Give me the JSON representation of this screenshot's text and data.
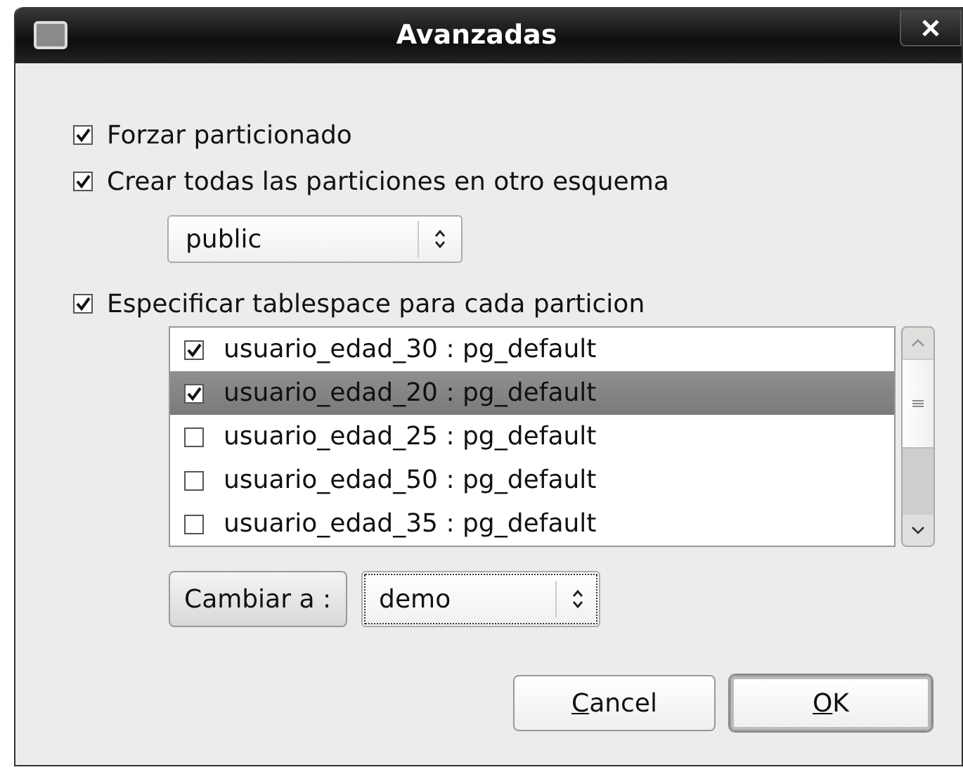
{
  "window": {
    "title": "Avanzadas"
  },
  "options": [
    {
      "label": "Forzar particionado",
      "checked": true
    },
    {
      "label": "Crear todas las particiones en otro esquema",
      "checked": true
    }
  ],
  "schema_combo": {
    "value": "public"
  },
  "tablespace_option": {
    "label": "Especificar tablespace para cada particion",
    "checked": true
  },
  "partitions": [
    {
      "label": "usuario_edad_30 : pg_default",
      "checked": true,
      "selected": false
    },
    {
      "label": "usuario_edad_20 : pg_default",
      "checked": true,
      "selected": true
    },
    {
      "label": "usuario_edad_25 : pg_default",
      "checked": false,
      "selected": false
    },
    {
      "label": "usuario_edad_50 : pg_default",
      "checked": false,
      "selected": false
    },
    {
      "label": "usuario_edad_35 : pg_default",
      "checked": false,
      "selected": false
    }
  ],
  "change_button": {
    "label": "Cambiar a :"
  },
  "tablespace_combo": {
    "value": "demo",
    "focused": true
  },
  "buttons": [
    {
      "label": "Cancel",
      "default": false,
      "mnemonic": true
    },
    {
      "label": "OK",
      "default": true,
      "mnemonic": true
    }
  ]
}
